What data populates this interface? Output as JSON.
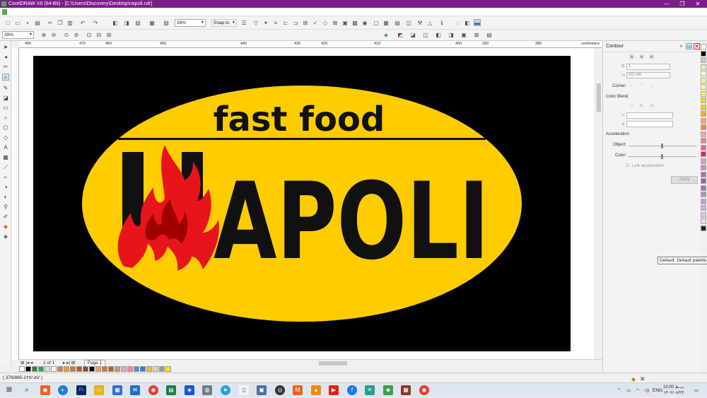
{
  "window": {
    "title": "CorelDRAW X6 (64-Bit) - [C:\\Users\\Discovery\\Desktop\\napoli.cdr]",
    "controls": [
      "—",
      "❐",
      "✕"
    ]
  },
  "toolbar": {
    "zoom_value": "39%",
    "snap_to_label": "Snap to"
  },
  "property_bar": {
    "zoom_value": "39%"
  },
  "ruler": {
    "h_ticks": [
      "480",
      "470",
      "460",
      "450",
      "440",
      "430",
      "420",
      "410",
      "400",
      "390",
      "380"
    ],
    "units": "centimeters"
  },
  "artwork": {
    "tagline": "fast food",
    "brand_letters": "APOLI",
    "colors": {
      "background": "#000000",
      "oval": "#FFCC00",
      "text": "#111111",
      "flame_red": "#E8141C",
      "flame_dark": "#A00000"
    }
  },
  "page_nav": {
    "page_count": "1 of 1",
    "page_tab": "Page 1"
  },
  "status": {
    "coords": "( 376/865-1۲۷/-۵V )"
  },
  "docker": {
    "title": "Contour",
    "steps_value": "1",
    "offset_value": "0/2 cm",
    "corner_label": "Corner:",
    "color_blend_label": "Color Blend",
    "acceleration_label": "Acceleration",
    "object_label": "Object:",
    "color_label": "Color:",
    "link_acceleration_label": "Link acceleration",
    "apply_label": "Apply"
  },
  "tooltip": "Default: Default palette",
  "palette_colors_h": [
    "#ffffff",
    "#000000",
    "#3a7d44",
    "#2fa84f",
    "#e0e0e0",
    "#ffffff",
    "#e07b39",
    "#f09a3c",
    "#c87941",
    "#b05c2a",
    "#8a4a2a",
    "#000000",
    "#e8a060",
    "#d4703a",
    "#9c6a3a",
    "#c49a7a",
    "#f4a6a6",
    "#f28c8c",
    "#5b8fd0",
    "#2b7fd6",
    "#f5b942",
    "#f7d09c",
    "#999999",
    "#ffe800"
  ],
  "palette_colors_v": [
    "#ffffff",
    "#000000",
    "#cccccc",
    "#eeeeaa",
    "#ffffcc",
    "#f5ecb0",
    "#fff59d",
    "#ffee58",
    "#f9d71c",
    "#ffcc00",
    "#f4b400",
    "#f7a072",
    "#f28c28",
    "#f4a6a6",
    "#f28080",
    "#f06292",
    "#e91e63",
    "#d4a0c0",
    "#c890c0",
    "#b070a8",
    "#9b59b6",
    "#a070b0",
    "#b090c0",
    "#c0a0d0",
    "#d0b0e0",
    "#e0c0e8",
    "#f0d0f0",
    "#222222"
  ],
  "taskbar": {
    "language": "ENG",
    "time": "10:00 ب.ظ",
    "date": "۱۴۰۲/۰۸/۲۳"
  }
}
